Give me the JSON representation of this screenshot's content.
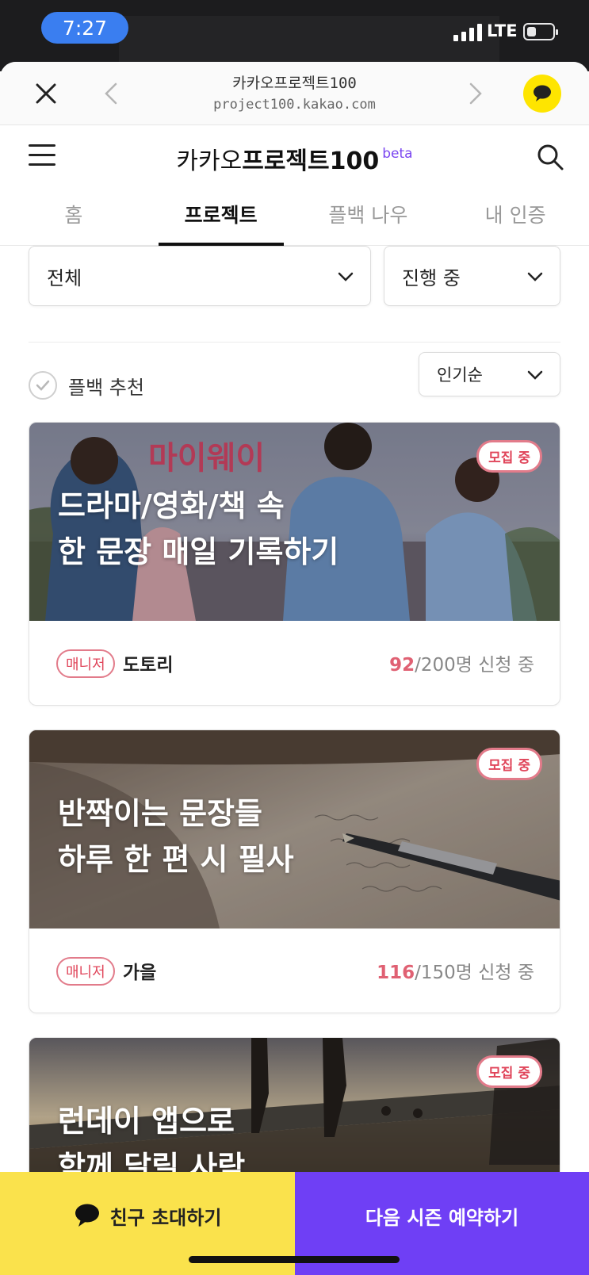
{
  "status": {
    "time": "7:27",
    "network": "LTE",
    "battery_level": 0.35
  },
  "browser": {
    "page_title": "카카오프로젝트100",
    "host": "project100.kakao.com"
  },
  "site": {
    "logo_regular": "카카오",
    "logo_bold": "프로젝트100",
    "logo_badge": "beta"
  },
  "tabs": [
    {
      "label": "홈",
      "active": false
    },
    {
      "label": "프로젝트",
      "active": true
    },
    {
      "label": "플백 나우",
      "active": false
    },
    {
      "label": "내 인증",
      "active": false
    }
  ],
  "filters": {
    "category": "전체",
    "status": "진행 중",
    "sort": "인기순",
    "recommend_label": "플백 추천"
  },
  "cards": [
    {
      "title_line1": "드라마/영화/책 속",
      "title_line2": "한 문장 매일 기록하기",
      "poster_text": "마이웨이",
      "badge": "모집 중",
      "manager_label": "매니저",
      "manager": "도토리",
      "applied": "92",
      "capacity_text": "/200명 신청 중"
    },
    {
      "title_line1": "반짝이는 문장들",
      "title_line2": "하루 한 편 시 필사",
      "badge": "모집 중",
      "manager_label": "매니저",
      "manager": "가을",
      "applied": "116",
      "capacity_text": "/150명 신청 중"
    },
    {
      "title_line1": "런데이 앱으로",
      "title_line2": "함께 달릴 사람",
      "badge": "모집 중"
    }
  ],
  "bottom": {
    "invite_label": "친구 초대하기",
    "reserve_label": "다음 시즌 예약하기"
  },
  "colors": {
    "accent_yellow": "#fae24c",
    "accent_purple": "#6f3ff5",
    "badge_pink": "#e0455a",
    "time_pill": "#3a7ef0"
  }
}
